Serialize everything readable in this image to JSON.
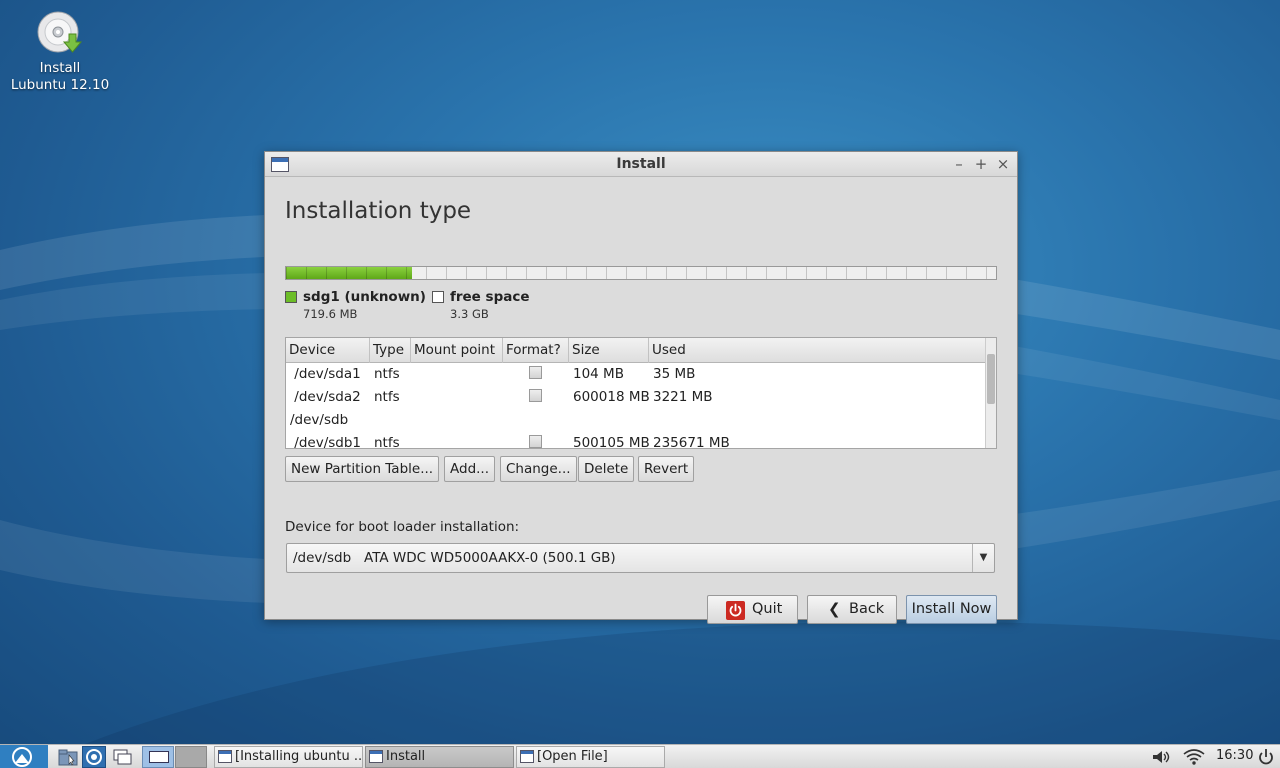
{
  "desktop": {
    "icons": [
      {
        "label_line1": "Install",
        "label_line2": "Lubuntu 12.10",
        "icon": "cd-install-icon"
      }
    ]
  },
  "window": {
    "title": "Install",
    "controls": {
      "minimize": "–",
      "maximize": "+",
      "close": "×"
    },
    "heading": "Installation type",
    "partition_bar": {
      "used_fraction": 0.178,
      "used_color": "#6cbd27"
    },
    "legend": [
      {
        "name": "sdg1 (unknown)",
        "size": "719.6 MB",
        "color": "#6cbd27"
      },
      {
        "name": "free space",
        "size": "3.3 GB",
        "color": "#ffffff"
      }
    ],
    "table": {
      "headers": [
        "Device",
        "Type",
        "Mount point",
        "Format?",
        "Size",
        "Used"
      ],
      "rows": [
        {
          "device": " /dev/sda1",
          "type": "ntfs",
          "mount": "",
          "format": false,
          "size": "104 MB",
          "used": "35 MB"
        },
        {
          "device": " /dev/sda2",
          "type": "ntfs",
          "mount": "",
          "format": false,
          "size": "600018 MB",
          "used": "3221 MB"
        },
        {
          "device": "/dev/sdb",
          "type": "",
          "mount": "",
          "format": null,
          "size": "",
          "used": ""
        },
        {
          "device": " /dev/sdb1",
          "type": "ntfs",
          "mount": "",
          "format": false,
          "size": "500105 MB",
          "used": "235671 MB"
        }
      ]
    },
    "table_buttons": {
      "new_table": "New Partition Table...",
      "add": "Add...",
      "change": "Change...",
      "delete": "Delete",
      "revert": "Revert"
    },
    "boot_loader": {
      "label": "Device for boot loader installation:",
      "selected": "/dev/sdb   ATA WDC WD5000AAKX-0 (500.1 GB)"
    },
    "actions": {
      "quit": "Quit",
      "back": "Back",
      "install": "Install Now"
    }
  },
  "taskbar": {
    "tasks": [
      {
        "label": "[Installing ubuntu ...",
        "active": false
      },
      {
        "label": "Install",
        "active": true
      },
      {
        "label": "[Open File]",
        "active": false
      }
    ],
    "clock": "16:30"
  }
}
